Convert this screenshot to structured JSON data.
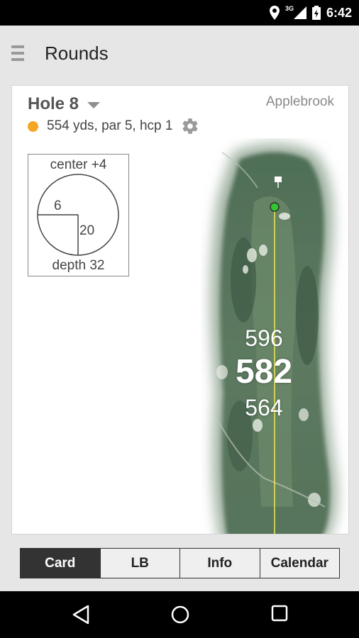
{
  "status": {
    "time": "6:42",
    "network": "3G"
  },
  "appbar": {
    "title": "Rounds",
    "menu_icon": "hamburger-icon"
  },
  "hole": {
    "title": "Hole 8",
    "course": "Applebrook",
    "info": "554 yds, par 5, hcp 1",
    "dot_color": "#f6a623"
  },
  "dispersion": {
    "center": "center +4",
    "left": "6",
    "right": "20",
    "depth": "depth 32"
  },
  "map": {
    "yards_back": "596",
    "yards_middle": "582",
    "yards_front": "564",
    "pin_color": "#35c335",
    "line_color": "#f0e850"
  },
  "tabs": [
    {
      "label": "Card",
      "active": true
    },
    {
      "label": "LB",
      "active": false
    },
    {
      "label": "Info",
      "active": false
    },
    {
      "label": "Calendar",
      "active": false
    }
  ]
}
